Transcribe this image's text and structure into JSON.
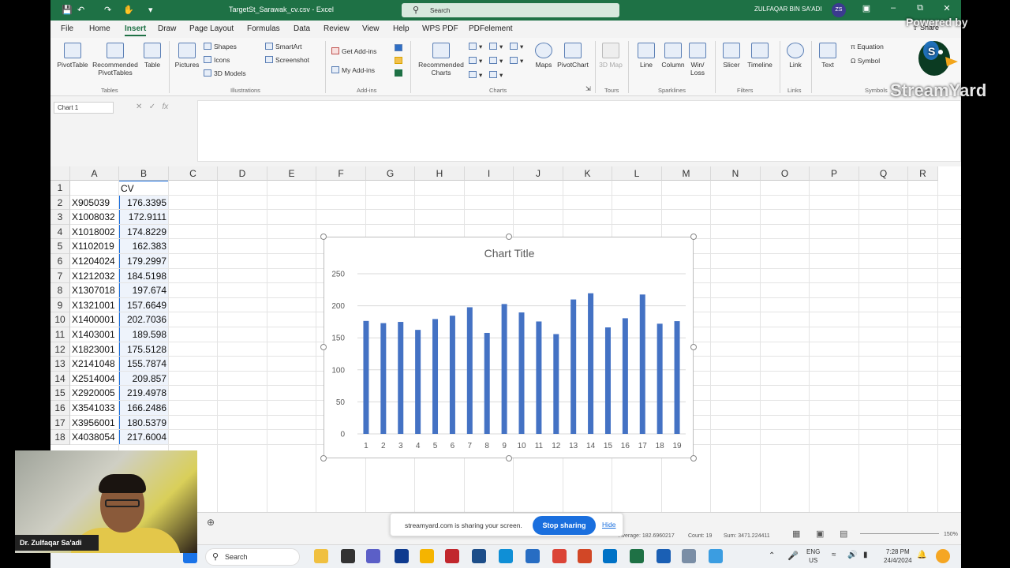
{
  "titlebar": {
    "filename": "TargetSt_Sarawak_cv.csv - Excel",
    "search_placeholder": "Search",
    "user": "ZULFAQAR BIN SA'ADI",
    "initials": "ZS"
  },
  "menu": {
    "items": [
      "File",
      "Home",
      "Insert",
      "Draw",
      "Page Layout",
      "Formulas",
      "Data",
      "Review",
      "View",
      "Help",
      "WPS PDF",
      "PDFelement"
    ],
    "active": "Insert",
    "share": "Share"
  },
  "ribbon": {
    "pivottable": "PivotTable",
    "recommended_pivottables": "Recommended PivotTables",
    "table": "Table",
    "pictures": "Pictures",
    "shapes": "Shapes",
    "icons": "Icons",
    "models3d": "3D Models",
    "smartart": "SmartArt",
    "screenshot": "Screenshot",
    "get_addins": "Get Add-ins",
    "my_addins": "My Add-ins",
    "recommended_charts": "Recommended Charts",
    "maps": "Maps",
    "pivotchart": "PivotChart",
    "map3d": "3D Map",
    "line": "Line",
    "column": "Column",
    "winloss": "Win/ Loss",
    "slicer": "Slicer",
    "timeline": "Timeline",
    "link": "Link",
    "text": "Text",
    "equation": "Equation",
    "symbol": "Symbol",
    "groups": {
      "tables": "Tables",
      "illustrations": "Illustrations",
      "addins": "Add-ins",
      "charts": "Charts",
      "tours": "Tours",
      "sparklines": "Sparklines",
      "filters": "Filters",
      "links": "Links",
      "symbols": "Symbols"
    }
  },
  "formula_bar": {
    "namebox": "Chart 1",
    "fx": "fx"
  },
  "sheet": {
    "columns": [
      "A",
      "B",
      "C",
      "D",
      "E",
      "F",
      "G",
      "H",
      "I",
      "J",
      "K",
      "L",
      "M",
      "N",
      "O",
      "P",
      "Q",
      "R"
    ],
    "header_row": {
      "a": "",
      "b": "CV"
    },
    "rows": [
      {
        "n": "2",
        "a": "X905039",
        "b": "176.3395"
      },
      {
        "n": "3",
        "a": "X1008032",
        "b": "172.9111"
      },
      {
        "n": "4",
        "a": "X1018002",
        "b": "174.8229"
      },
      {
        "n": "5",
        "a": "X1102019",
        "b": "162.383"
      },
      {
        "n": "6",
        "a": "X1204024",
        "b": "179.2997"
      },
      {
        "n": "7",
        "a": "X1212032",
        "b": "184.5198"
      },
      {
        "n": "8",
        "a": "X1307018",
        "b": "197.674"
      },
      {
        "n": "9",
        "a": "X1321001",
        "b": "157.6649"
      },
      {
        "n": "10",
        "a": "X1400001",
        "b": "202.7036"
      },
      {
        "n": "11",
        "a": "X1403001",
        "b": "189.598"
      },
      {
        "n": "12",
        "a": "X1823001",
        "b": "175.5128"
      },
      {
        "n": "13",
        "a": "X2141048",
        "b": "155.7874"
      },
      {
        "n": "14",
        "a": "X2514004",
        "b": "209.857"
      },
      {
        "n": "15",
        "a": "X2920005",
        "b": "219.4978"
      },
      {
        "n": "16",
        "a": "X3541033",
        "b": "166.2486"
      },
      {
        "n": "17",
        "a": "X3956001",
        "b": "180.5379"
      },
      {
        "n": "18",
        "a": "X4038054",
        "b": "217.6004"
      }
    ]
  },
  "chart_data": {
    "type": "bar",
    "title": "Chart Title",
    "categories": [
      "1",
      "2",
      "3",
      "4",
      "5",
      "6",
      "7",
      "8",
      "9",
      "10",
      "11",
      "12",
      "13",
      "14",
      "15",
      "16",
      "17",
      "18",
      "19"
    ],
    "values": [
      176.3395,
      172.9111,
      174.8229,
      162.383,
      179.2997,
      184.5198,
      197.674,
      157.6649,
      202.7036,
      189.598,
      175.5128,
      155.7874,
      209.857,
      219.4978,
      166.2486,
      180.5379,
      217.6004,
      172,
      176
    ],
    "ylim": [
      0,
      250
    ],
    "yticks": [
      0,
      50,
      100,
      150,
      200,
      250
    ],
    "grid": true,
    "bar_color": "#4472c4"
  },
  "statusbar": {
    "average": "Average: 182.6960217",
    "count": "Count: 19",
    "sum": "Sum: 3471.224411",
    "zoom": "150%"
  },
  "sharing": {
    "message": "streamyard.com is sharing your screen.",
    "stop": "Stop sharing",
    "hide": "Hide"
  },
  "taskbar": {
    "search": "Search",
    "lang1": "ENG",
    "lang2": "US",
    "time": "7:28 PM",
    "date": "24/4/2024"
  },
  "overlay": {
    "presenter": "Dr. Zulfaqar Sa'adi",
    "powered_by": "Powered by",
    "brand": "StreamYard"
  },
  "colors": {
    "excel_green": "#1e7145",
    "accent_blue": "#1a6fde"
  }
}
